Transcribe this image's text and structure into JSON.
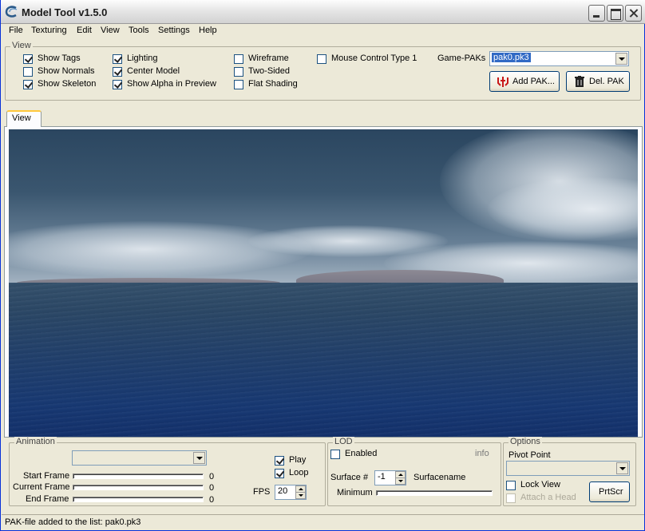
{
  "window": {
    "title": "Model Tool v1.5.0"
  },
  "menu": [
    "File",
    "Texturing",
    "Edit",
    "View",
    "Tools",
    "Settings",
    "Help"
  ],
  "view_group": {
    "label": "View",
    "checkboxes": [
      {
        "label": "Show Tags",
        "checked": true
      },
      {
        "label": "Show Normals",
        "checked": false
      },
      {
        "label": "Show Skeleton",
        "checked": true
      },
      {
        "label": "Lighting",
        "checked": true
      },
      {
        "label": "Center Model",
        "checked": true
      },
      {
        "label": "Show Alpha in Preview",
        "checked": true
      },
      {
        "label": "Wireframe",
        "checked": false
      },
      {
        "label": "Two-Sided",
        "checked": false
      },
      {
        "label": "Flat Shading",
        "checked": false
      },
      {
        "label": "Mouse Control Type 1",
        "checked": false
      }
    ],
    "game_paks_label": "Game-PAKs",
    "game_paks_value": "pak0.pk3",
    "add_pak_label": "Add PAK...",
    "del_pak_label": "Del. PAK"
  },
  "tabs": [
    "View"
  ],
  "animation": {
    "label": "Animation",
    "combo_value": "",
    "start_frame_label": "Start Frame",
    "start_frame_value": "0",
    "current_frame_label": "Current Frame",
    "current_frame_value": "0",
    "end_frame_label": "End Frame",
    "end_frame_value": "0",
    "play_label": "Play",
    "play_checked": true,
    "loop_label": "Loop",
    "loop_checked": true,
    "fps_label": "FPS",
    "fps_value": "20"
  },
  "lod": {
    "label": "LOD",
    "enabled_label": "Enabled",
    "enabled_checked": false,
    "info_label": "info",
    "surface_label": "Surface #",
    "surface_value": "-1",
    "surfacename_label": "Surfacename",
    "minimum_label": "Minimum"
  },
  "options": {
    "label": "Options",
    "pivot_label": "Pivot Point",
    "pivot_value": "",
    "lock_view_label": "Lock View",
    "lock_view_checked": false,
    "attach_head_label": "Attach a Head",
    "attach_head_checked": false,
    "prtscr_label": "PrtScr"
  },
  "status": "PAK-file added to the list: pak0.pk3"
}
